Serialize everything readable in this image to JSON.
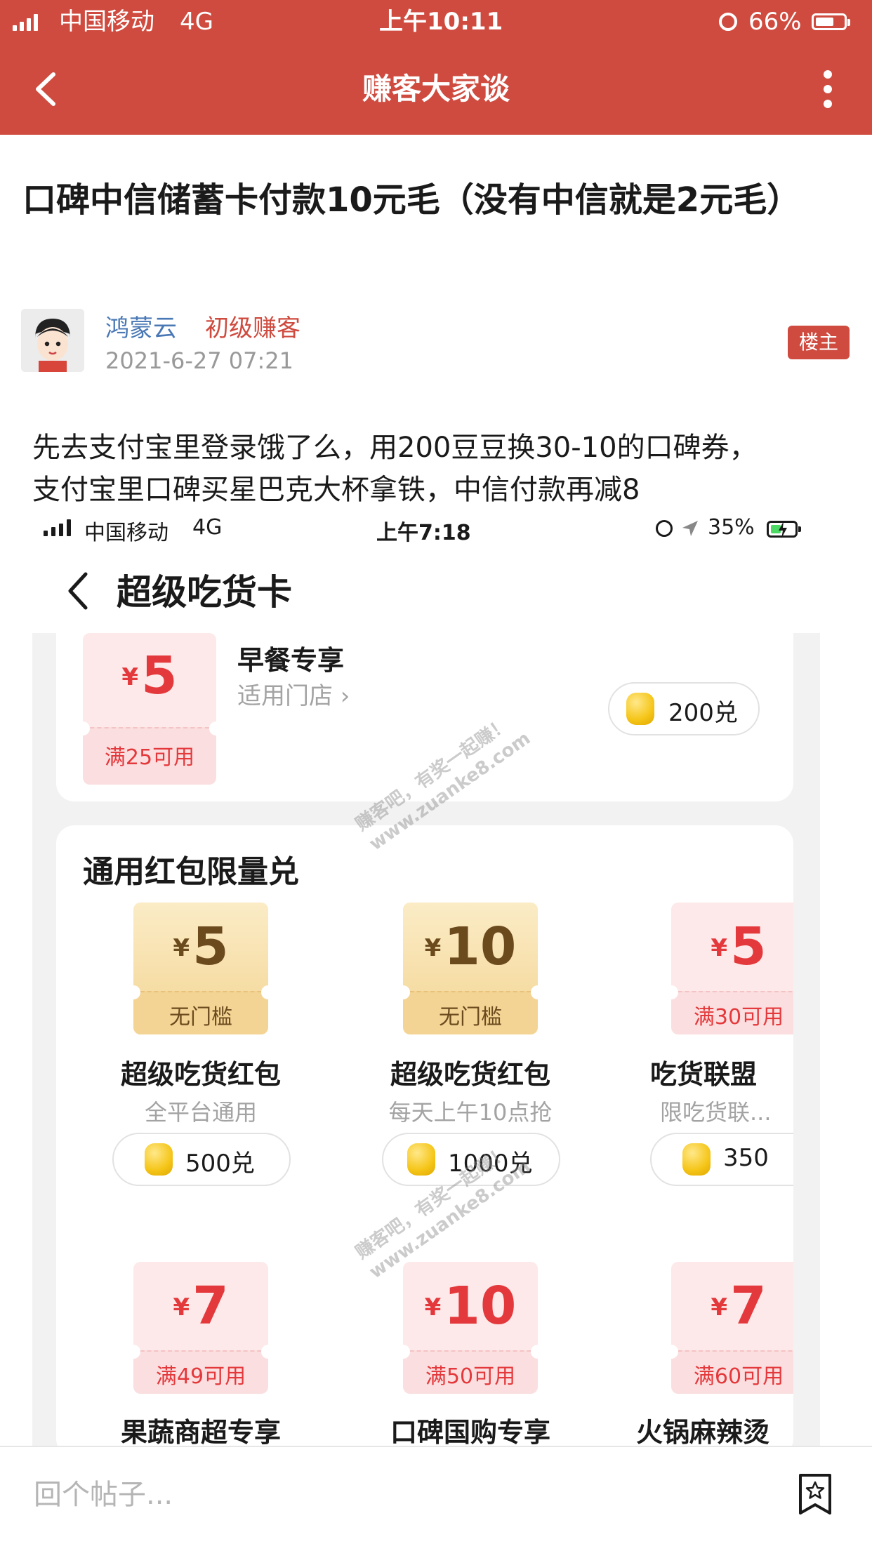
{
  "status_bar": {
    "carrier": "中国移动",
    "network": "4G",
    "time": "上午10:11",
    "battery": "66%",
    "battery_level": 0.66
  },
  "header": {
    "title": "赚客大家谈",
    "back_icon": "chevron-left-icon",
    "more_icon": "more-vertical-icon"
  },
  "post": {
    "title": "口碑中信储蓄卡付款10元毛（没有中信就是2元毛）",
    "author": {
      "name": "鸿蒙云",
      "level": "初级赚客",
      "time": "2021-6-27 07:21",
      "badge": "楼主"
    },
    "body_line1": "先去支付宝里登录饿了么，用200豆豆换30-10的口碑券，",
    "body_line2": "支付宝里口碑买星巴克大杯拿铁，中信付款再减8"
  },
  "screenshot": {
    "status_bar": {
      "carrier": "中国移动",
      "network": "4G",
      "time": "上午7:18",
      "battery": "35%"
    },
    "page_title": "超级吃货卡",
    "breakfast_card": {
      "currency": "¥",
      "amount": "5",
      "condition": "满25可用",
      "name": "早餐专享",
      "stores_link": "适用门店 ›",
      "price": "200兑"
    },
    "section_title": "通用红包限量兑",
    "row1": [
      {
        "currency": "¥",
        "amount": "5",
        "condition": "无门槛",
        "name": "超级吃货红包",
        "sub": "全平台通用",
        "price": "500兑",
        "style": "gold"
      },
      {
        "currency": "¥",
        "amount": "10",
        "condition": "无门槛",
        "name": "超级吃货红包",
        "sub": "每天上午10点抢",
        "price": "1000兑",
        "style": "gold"
      },
      {
        "currency": "¥",
        "amount": "5",
        "condition": "满30可用",
        "name": "吃货联盟",
        "sub": "限吃货联...",
        "price": "350",
        "style": "red"
      }
    ],
    "row2": [
      {
        "currency": "¥",
        "amount": "7",
        "condition": "满49可用",
        "name": "果蔬商超专享",
        "style": "red"
      },
      {
        "currency": "¥",
        "amount": "10",
        "condition": "满50可用",
        "name": "口碑国购专享",
        "style": "red"
      },
      {
        "currency": "¥",
        "amount": "7",
        "condition": "满60可用",
        "name": "火锅麻辣烫",
        "style": "red"
      }
    ],
    "watermark_line1": "赚客吧，有奖一起赚！",
    "watermark_line2": "www.zuanke8.com"
  },
  "bottom_bar": {
    "reply_placeholder": "回个帖子...",
    "favorite_icon": "star-bookmark-icon"
  }
}
